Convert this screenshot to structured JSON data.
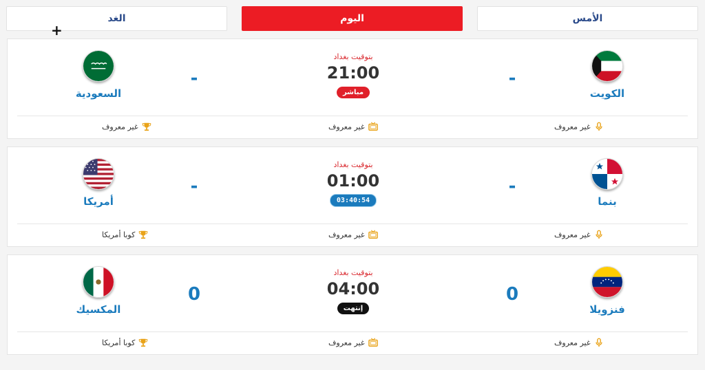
{
  "tabs": {
    "tomorrow": "الغد",
    "today": "اليوم",
    "yesterday": "الأمس"
  },
  "colors": {
    "accent": "#ec1c24",
    "team_blue": "#1b7bbd",
    "icon_gold": "#e9a319"
  },
  "icons": {
    "commentator": "microphone-icon",
    "channel": "tv-icon",
    "league": "trophy-icon"
  },
  "matches": [
    {
      "home": {
        "name": "الكويت",
        "flag": "kuwait-flag"
      },
      "away": {
        "name": "السعودية",
        "flag": "saudi-arabia-flag"
      },
      "home_score": "-",
      "away_score": "-",
      "tz_label": "بتوقيت بغداد",
      "time": "21:00",
      "status": {
        "type": "live",
        "text": "مباشر"
      },
      "commentator": "غير معروف",
      "channel": "غير معروف",
      "league": "غير معروف"
    },
    {
      "home": {
        "name": "بنما",
        "flag": "panama-flag"
      },
      "away": {
        "name": "أمريكا",
        "flag": "usa-flag"
      },
      "home_score": "-",
      "away_score": "-",
      "tz_label": "بتوقيت بغداد",
      "time": "01:00",
      "status": {
        "type": "countdown",
        "text": "03:40:54"
      },
      "commentator": "غير معروف",
      "channel": "غير معروف",
      "league": "كوبا أمريكا"
    },
    {
      "home": {
        "name": "فنزويلا",
        "flag": "venezuela-flag"
      },
      "away": {
        "name": "المكسيك",
        "flag": "mexico-flag"
      },
      "home_score": "0",
      "away_score": "0",
      "tz_label": "بتوقيت بغداد",
      "time": "04:00",
      "status": {
        "type": "ended",
        "text": "إنتهت"
      },
      "commentator": "غير معروف",
      "channel": "غير معروف",
      "league": "كوبا أمريكا"
    }
  ]
}
